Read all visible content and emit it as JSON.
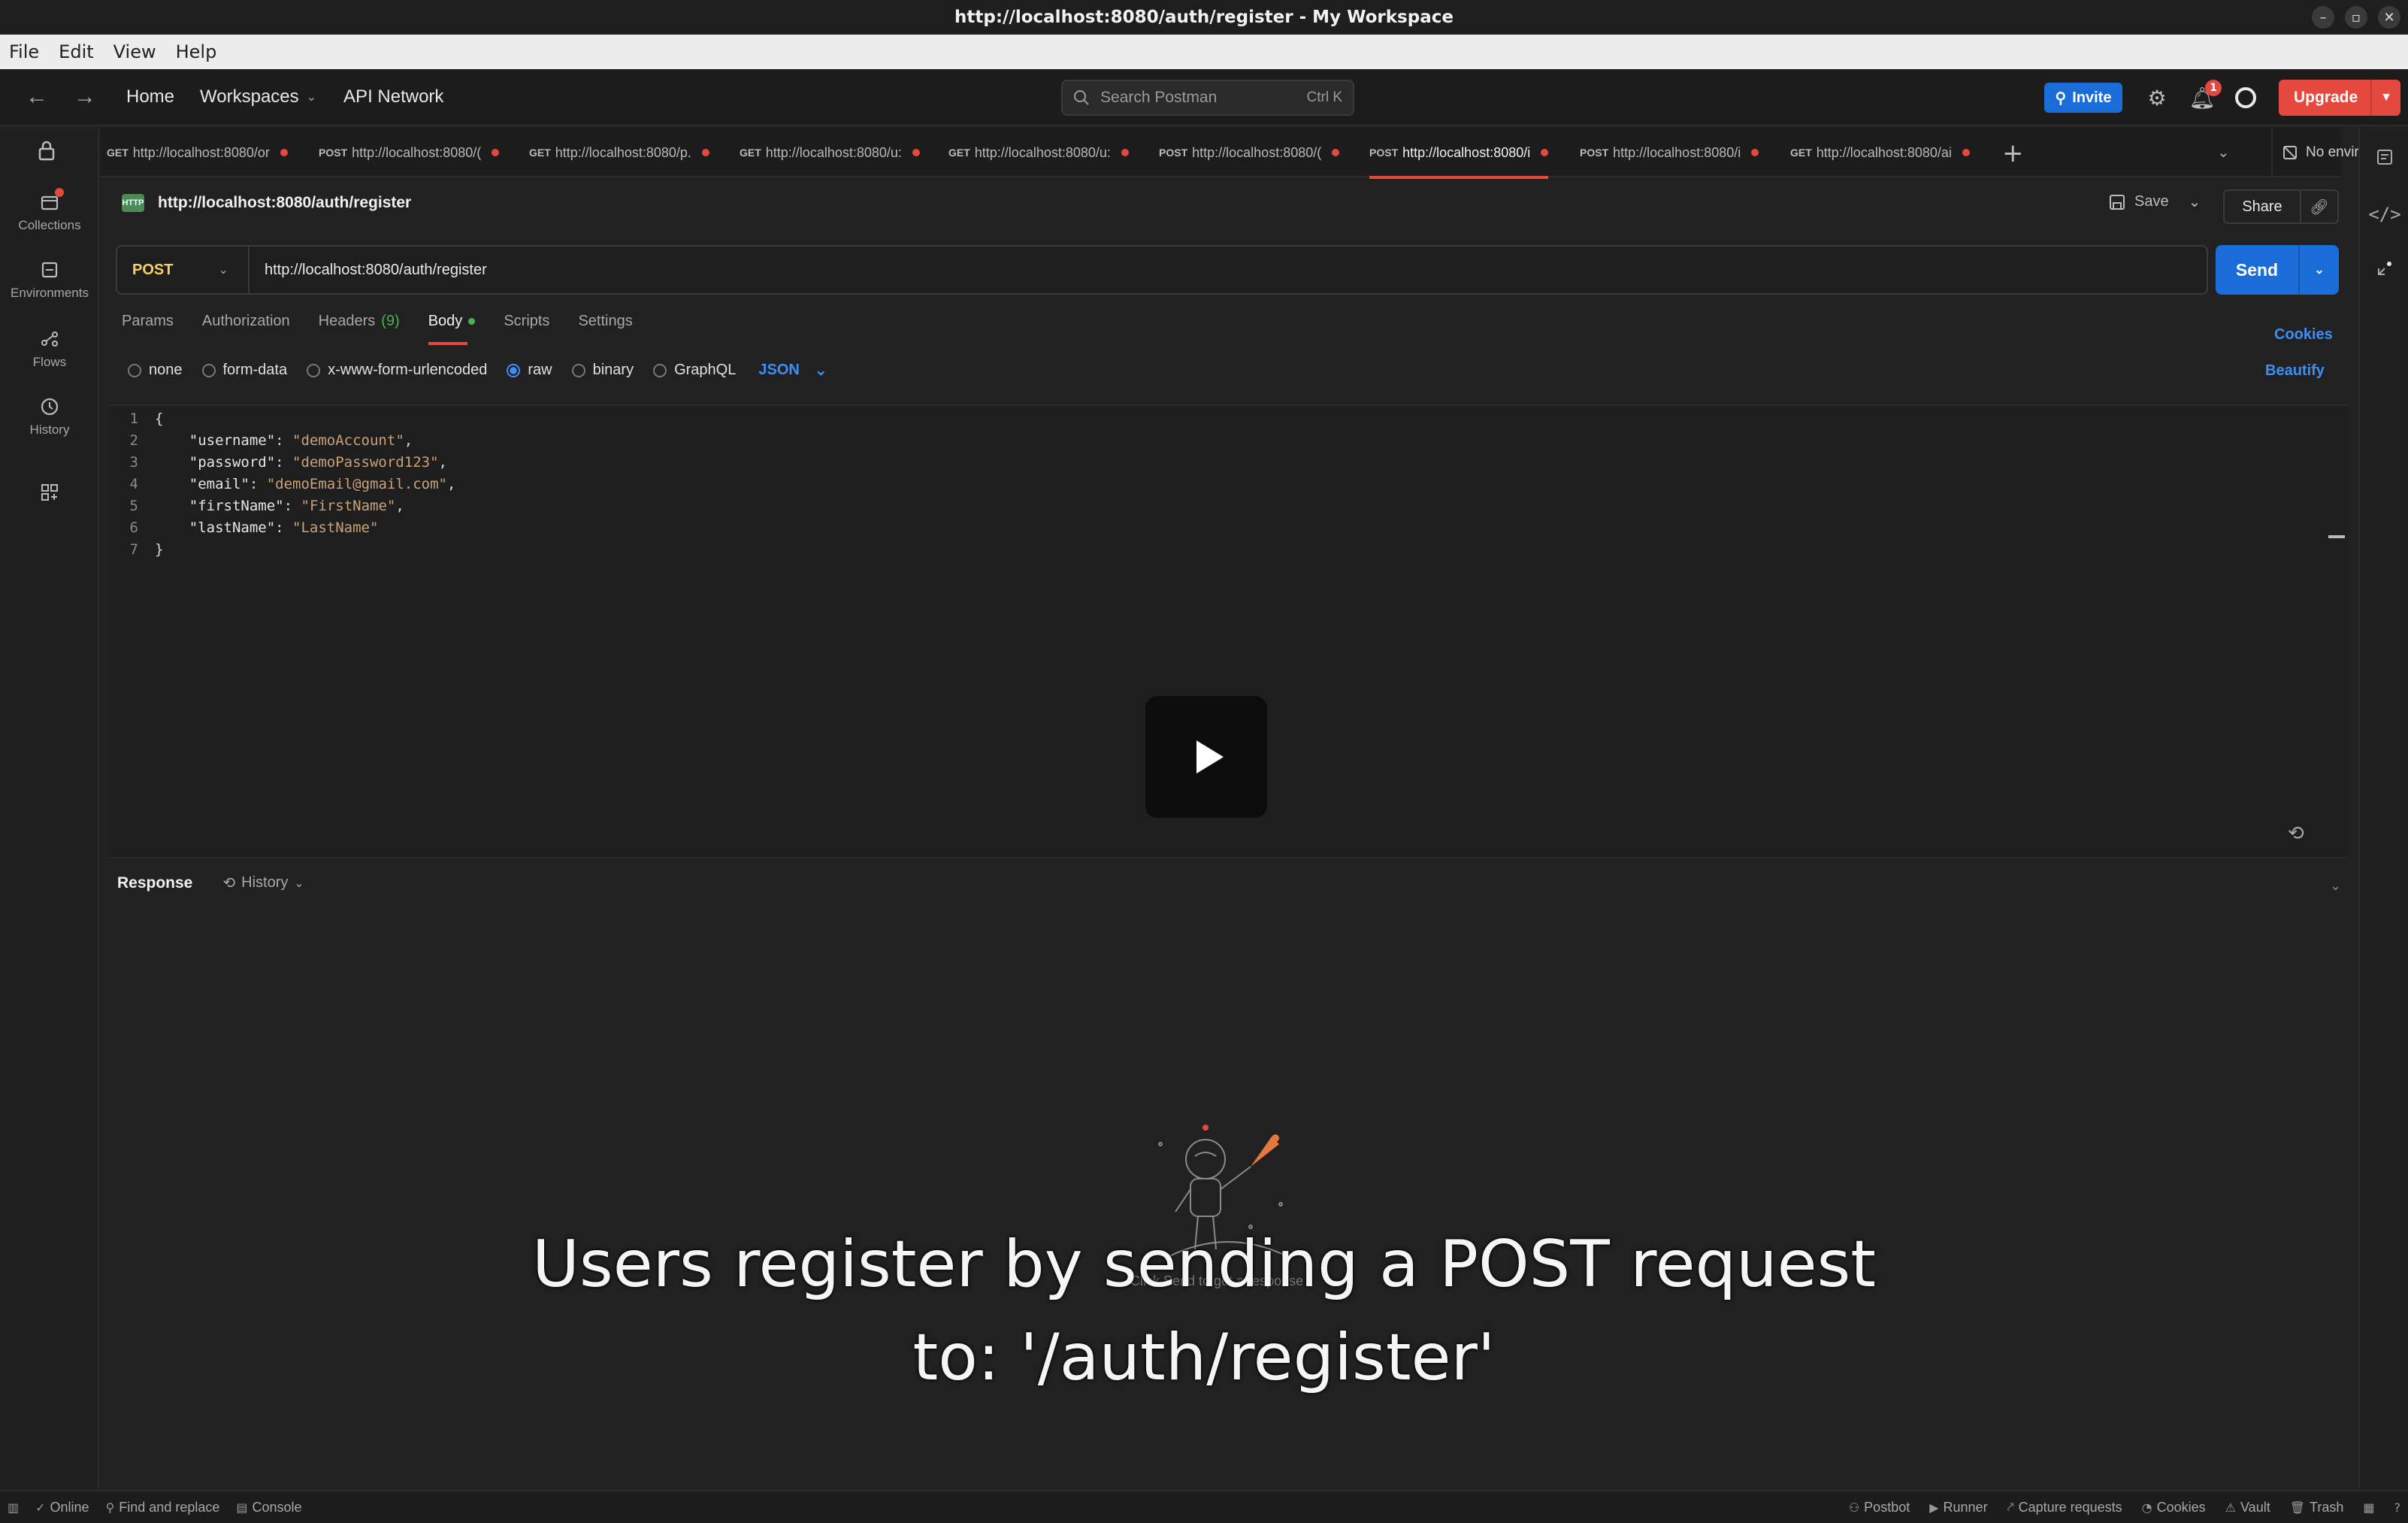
{
  "window": {
    "title": "http://localhost:8080/auth/register - My Workspace"
  },
  "menu": [
    "File",
    "Edit",
    "View",
    "Help"
  ],
  "header": {
    "home": "Home",
    "workspaces": "Workspaces",
    "api_network": "API Network",
    "search_placeholder": "Search Postman",
    "search_shortcut": "Ctrl  K",
    "invite": "Invite",
    "notification_count": "1",
    "upgrade": "Upgrade"
  },
  "sidebar": {
    "items": [
      {
        "label": "Collections",
        "icon": "collections-icon"
      },
      {
        "label": "Environments",
        "icon": "environments-icon"
      },
      {
        "label": "Flows",
        "icon": "flows-icon"
      },
      {
        "label": "History",
        "icon": "history-icon"
      }
    ]
  },
  "tabs": [
    {
      "method": "GET",
      "url": "http://localhost:8080/or"
    },
    {
      "method": "POST",
      "url": "http://localhost:8080/("
    },
    {
      "method": "GET",
      "url": "http://localhost:8080/p."
    },
    {
      "method": "GET",
      "url": "http://localhost:8080/u:"
    },
    {
      "method": "GET",
      "url": "http://localhost:8080/u:"
    },
    {
      "method": "POST",
      "url": "http://localhost:8080/("
    },
    {
      "method": "POST",
      "url": "http://localhost:8080/i",
      "active": true
    },
    {
      "method": "POST",
      "url": "http://localhost:8080/i"
    },
    {
      "method": "GET",
      "url": "http://localhost:8080/ai"
    }
  ],
  "environment": "No environment",
  "request": {
    "title": "http://localhost:8080/auth/register",
    "save": "Save",
    "share": "Share",
    "method": "POST",
    "url": "http://localhost:8080/auth/register",
    "send": "Send",
    "sub_tabs": {
      "params": "Params",
      "authorization": "Authorization",
      "headers": "Headers",
      "headers_count": "(9)",
      "body": "Body",
      "scripts": "Scripts",
      "settings": "Settings"
    },
    "cookies": "Cookies",
    "beautify": "Beautify",
    "body_types": [
      "none",
      "form-data",
      "x-www-form-urlencoded",
      "raw",
      "binary",
      "GraphQL"
    ],
    "selected_body_type": "raw",
    "format": "JSON",
    "code_lines": [
      {
        "n": "1",
        "text": "{"
      },
      {
        "n": "2",
        "key": "\"username\"",
        "value": "\"demoAccount\"",
        "tail": ","
      },
      {
        "n": "3",
        "key": "\"password\"",
        "value": "\"demoPassword123\"",
        "tail": ","
      },
      {
        "n": "4",
        "key": "\"email\"",
        "value": "\"demoEmail@gmail.com\"",
        "tail": ","
      },
      {
        "n": "5",
        "key": "\"firstName\"",
        "value": "\"FirstName\"",
        "tail": ","
      },
      {
        "n": "6",
        "key": "\"lastName\"",
        "value": "\"LastName\"",
        "tail": ""
      },
      {
        "n": "7",
        "text": "}"
      }
    ]
  },
  "response": {
    "label": "Response",
    "history": "History",
    "hint": "Click Send to get a response"
  },
  "caption": {
    "line1": "Users register by sending a POST request",
    "line2": "to: '/auth/register'"
  },
  "status_bar": {
    "online": "Online",
    "find_replace": "Find and replace",
    "console": "Console",
    "postbot": "Postbot",
    "runner": "Runner",
    "capture": "Capture requests",
    "cookies": "Cookies",
    "vault": "Vault",
    "trash": "Trash"
  },
  "colors": {
    "accent_orange": "#e5483d",
    "primary_blue": "#1a6dd9",
    "method_post": "#f6d264"
  }
}
